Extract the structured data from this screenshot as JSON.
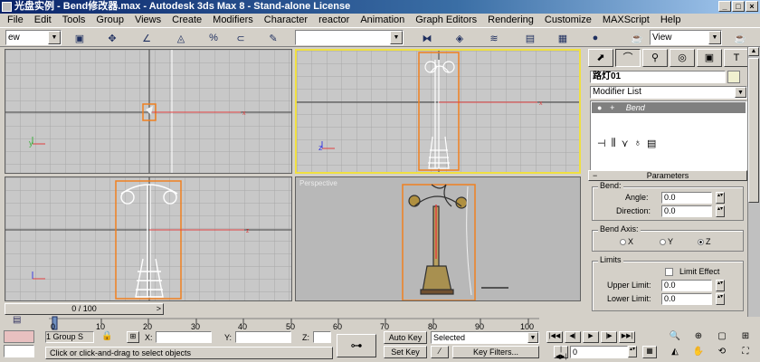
{
  "window": {
    "title": "光盘实例 - Bend修改器.max - Autodesk 3ds Max 8 - Stand-alone License",
    "controls": [
      "_",
      "□",
      "×"
    ]
  },
  "menu": [
    "File",
    "Edit",
    "Tools",
    "Group",
    "Views",
    "Create",
    "Modifiers",
    "Character",
    "reactor",
    "Animation",
    "Graph Editors",
    "Rendering",
    "Customize",
    "MAXScript",
    "Help"
  ],
  "toolbar": {
    "selection_filter": "ew",
    "named_selection": "",
    "view_combo": "View",
    "icons": [
      "select-object-icon",
      "select-by-name-icon",
      "select-and-move-icon",
      "undo-icon",
      "angle-snap-icon",
      "percent-snap-icon",
      "spinner-snap-icon",
      "edit-named-selection-icon",
      "mirror-icon",
      "align-icon",
      "layer-manager-icon",
      "curve-editor-icon",
      "schematic-view-icon",
      "material-editor-icon",
      "render-scene-icon",
      "quick-render-icon"
    ]
  },
  "viewports": {
    "top": {
      "label": ""
    },
    "front": {
      "label": ""
    },
    "left": {
      "label": ""
    },
    "perspective": {
      "label": "Perspective"
    },
    "axis_x": "x",
    "axis_y": "y",
    "axis_z": "z"
  },
  "command_panel": {
    "tabs": [
      "create-tab",
      "modify-tab",
      "hierarchy-tab",
      "motion-tab",
      "display-tab",
      "utilities-tab"
    ],
    "object_name": "路灯01",
    "modifier_list": "Modifier List",
    "stack": [
      {
        "name": "Bend"
      }
    ],
    "rollout_title": "Parameters",
    "bend_group": "Bend:",
    "angle_label": "Angle:",
    "angle_value": "0.0",
    "direction_label": "Direction:",
    "direction_value": "0.0",
    "bend_axis_group": "Bend Axis:",
    "axis_options": [
      "X",
      "Y",
      "Z"
    ],
    "selected_axis": "Z",
    "limits_group": "Limits",
    "limit_effect_label": "Limit Effect",
    "upper_limit_label": "Upper Limit:",
    "upper_limit_value": "0.0",
    "lower_limit_label": "Lower Limit:",
    "lower_limit_value": "0.0"
  },
  "timeline": {
    "slider_label": "0 / 100",
    "ticks": [
      "0",
      "10",
      "20",
      "30",
      "40",
      "50",
      "60",
      "70",
      "80",
      "90",
      "100"
    ],
    "current_frame": "0"
  },
  "status": {
    "selection_count": "1 Group S",
    "x_label": "X:",
    "y_label": "Y:",
    "z_label": "Z:",
    "prompt": "Click or click-and-drag to select objects",
    "auto_key": "Auto Key",
    "set_key": "Set Key",
    "selected": "Selected",
    "key_filters": "Key Filters...",
    "frame_value": "0"
  },
  "colors": {
    "active_viewport_border": "#f0e040",
    "selection_bracket": "#f08020",
    "axis_x": "#e04040",
    "axis_y": "#40b040",
    "axis_z": "#4040e0",
    "title_start": "#0a246a"
  }
}
